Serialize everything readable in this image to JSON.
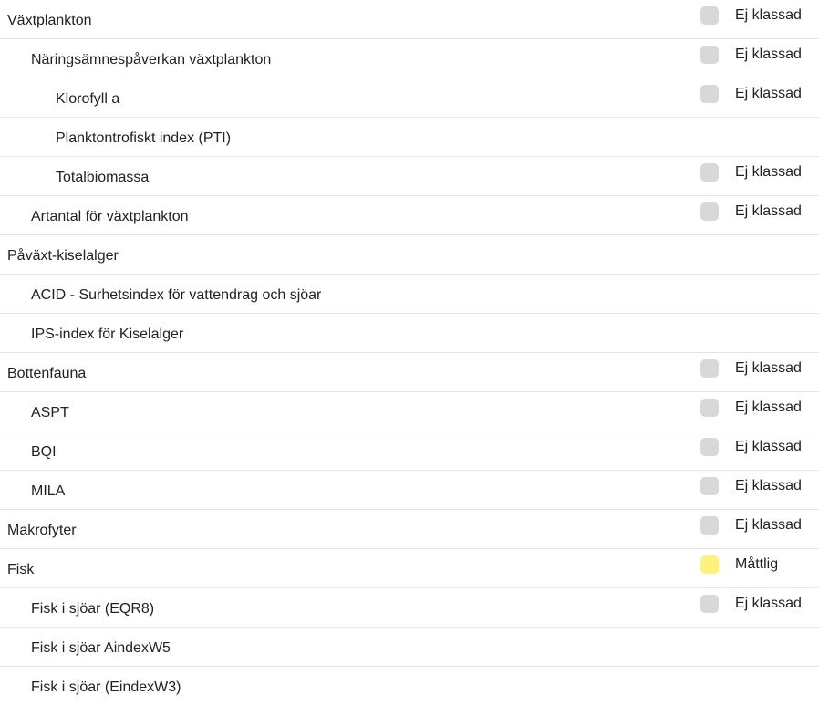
{
  "rows": [
    {
      "label": "Växtplankton",
      "level": 0,
      "status": "Ej klassad",
      "color": "#d8d8d8"
    },
    {
      "label": "Näringsämnespåverkan växtplankton",
      "level": 1,
      "status": "Ej klassad",
      "color": "#d8d8d8"
    },
    {
      "label": "Klorofyll a",
      "level": 2,
      "status": "Ej klassad",
      "color": "#d8d8d8"
    },
    {
      "label": "Planktontrofiskt index (PTI)",
      "level": 2,
      "status": "",
      "color": ""
    },
    {
      "label": "Totalbiomassa",
      "level": 2,
      "status": "Ej klassad",
      "color": "#d8d8d8"
    },
    {
      "label": "Artantal för växtplankton",
      "level": 1,
      "status": "Ej klassad",
      "color": "#d8d8d8"
    },
    {
      "label": "Påväxt-kiselalger",
      "level": 0,
      "status": "",
      "color": ""
    },
    {
      "label": "ACID - Surhetsindex för vattendrag och sjöar",
      "level": 1,
      "status": "",
      "color": ""
    },
    {
      "label": "IPS-index för Kiselalger",
      "level": 1,
      "status": "",
      "color": ""
    },
    {
      "label": "Bottenfauna",
      "level": 0,
      "status": "Ej klassad",
      "color": "#d8d8d8"
    },
    {
      "label": "ASPT",
      "level": 1,
      "status": "Ej klassad",
      "color": "#d8d8d8"
    },
    {
      "label": "BQI",
      "level": 1,
      "status": "Ej klassad",
      "color": "#d8d8d8"
    },
    {
      "label": "MILA",
      "level": 1,
      "status": "Ej klassad",
      "color": "#d8d8d8"
    },
    {
      "label": "Makrofyter",
      "level": 0,
      "status": "Ej klassad",
      "color": "#d8d8d8"
    },
    {
      "label": "Fisk",
      "level": 0,
      "status": "Måttlig",
      "color": "#fff27a"
    },
    {
      "label": "Fisk i sjöar (EQR8)",
      "level": 1,
      "status": "Ej klassad",
      "color": "#d8d8d8"
    },
    {
      "label": "Fisk i sjöar AindexW5",
      "level": 1,
      "status": "",
      "color": ""
    },
    {
      "label": "Fisk i sjöar (EindexW3)",
      "level": 1,
      "status": "",
      "color": ""
    }
  ]
}
